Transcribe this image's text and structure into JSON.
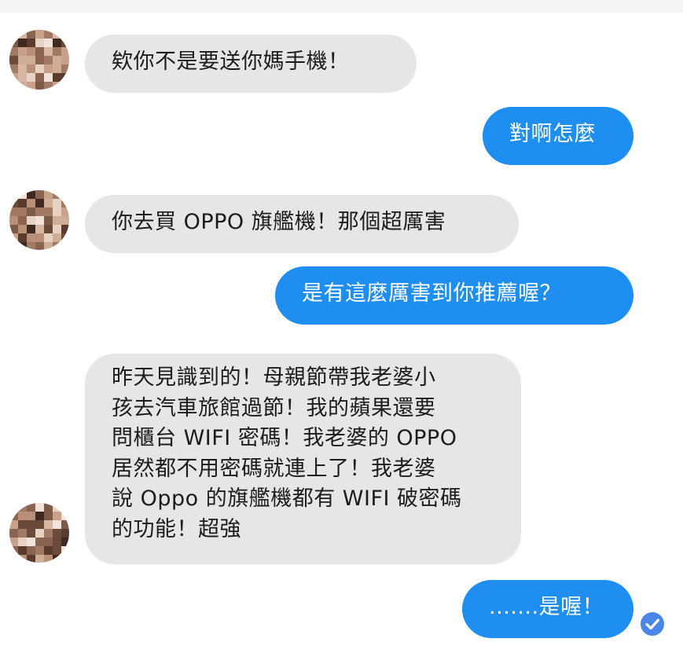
{
  "chat": {
    "messages": [
      {
        "sender": "contact",
        "text": "欸你不是要送你媽手機！"
      },
      {
        "sender": "me",
        "text": "對啊怎麼"
      },
      {
        "sender": "contact",
        "text": "你去買 OPPO 旗艦機！那個超厲害"
      },
      {
        "sender": "me",
        "text": "是有這麼厲害到你推薦喔？"
      },
      {
        "sender": "contact",
        "lines": [
          "昨天見識到的！母親節帶我老婆小",
          "孩去汽車旅館過節！我的蘋果還要",
          "問櫃台 WIFI 密碼！我老婆的 OPPO",
          "居然都不用密碼就連上了！我老婆",
          "說 Oppo 的旗艦機都有 WIFI 破密碼",
          "的功能！超強"
        ]
      },
      {
        "sender": "me",
        "text": ".......是喔！"
      }
    ],
    "read_status_icon": "seen-check-icon"
  },
  "colors": {
    "outgoing_bubble": "#1f8ef1",
    "incoming_bubble": "#e6e6e6",
    "seen_check": "#4a86e8"
  }
}
